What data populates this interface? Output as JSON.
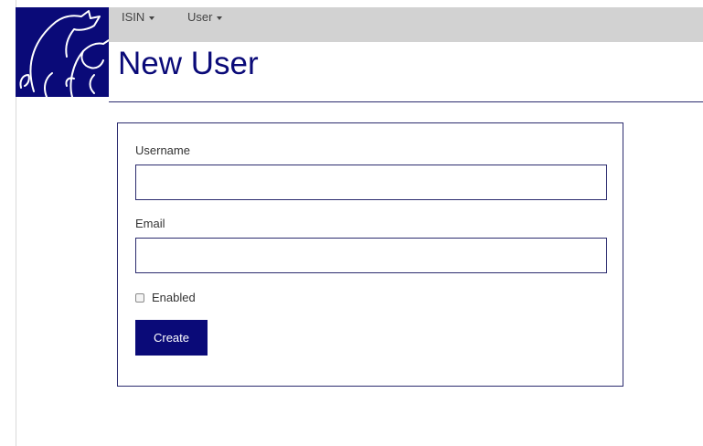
{
  "nav": {
    "items": [
      {
        "label": "ISIN",
        "icon": "caret-down-icon"
      },
      {
        "label": "User",
        "icon": "caret-down-icon"
      }
    ]
  },
  "page": {
    "title": "New User"
  },
  "form": {
    "username": {
      "label": "Username",
      "value": "",
      "placeholder": ""
    },
    "email": {
      "label": "Email",
      "value": "",
      "placeholder": ""
    },
    "enabled": {
      "label": "Enabled",
      "checked": false
    },
    "create_label": "Create"
  },
  "colors": {
    "brand": "#0a0a78",
    "nav_bar": "#d2d2d2",
    "border": "#2b2b6e"
  },
  "logo": {
    "icon": "bull-and-bear-logo-icon"
  }
}
